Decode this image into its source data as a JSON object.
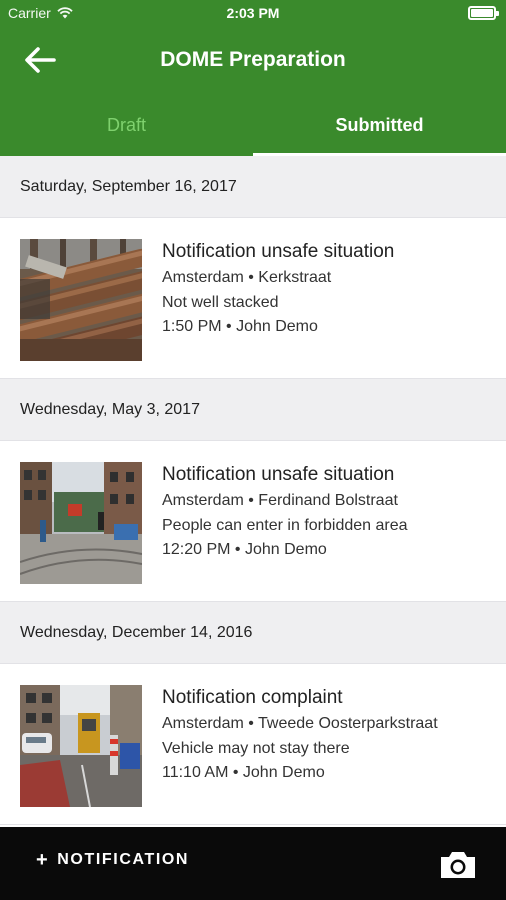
{
  "status_bar": {
    "carrier": "Carrier",
    "time": "2:03 PM",
    "icons": [
      "wifi-icon",
      "battery-icon"
    ]
  },
  "app_bar": {
    "title": "DOME Preparation",
    "back_icon": "arrow-left-icon"
  },
  "tabs": [
    {
      "label": "Draft",
      "active": false
    },
    {
      "label": "Submitted",
      "active": true
    }
  ],
  "sections": [
    {
      "date": "Saturday, September 16, 2017",
      "items": [
        {
          "title": "Notification unsafe situation",
          "location": "Amsterdam • Kerkstraat",
          "description": "Not well stacked",
          "meta": "1:50 PM • John Demo",
          "thumbnail": "stacked-pipes-photo"
        }
      ]
    },
    {
      "date": "Wednesday, May 3, 2017",
      "items": [
        {
          "title": "Notification unsafe situation",
          "location": "Amsterdam • Ferdinand Bolstraat",
          "description": "People can enter in forbidden area",
          "meta": "12:20 PM • John Demo",
          "thumbnail": "street-tram-photo"
        }
      ]
    },
    {
      "date": "Wednesday, December 14, 2016",
      "items": [
        {
          "title": "Notification complaint",
          "location": "Amsterdam • Tweede Oosterparkstraat",
          "description": "Vehicle may not stay there",
          "meta": "11:10 AM • John Demo",
          "thumbnail": "street-vehicle-photo"
        }
      ]
    }
  ],
  "bottom_bar": {
    "add_label": "NOTIFICATION",
    "add_icon": "plus-icon",
    "camera_icon": "camera-icon"
  },
  "colors": {
    "primary": "#3a8a2c",
    "tab_inactive": "#7fd16e",
    "section_bg": "#efeff1",
    "bottom_bar": "#0a0a0a"
  }
}
